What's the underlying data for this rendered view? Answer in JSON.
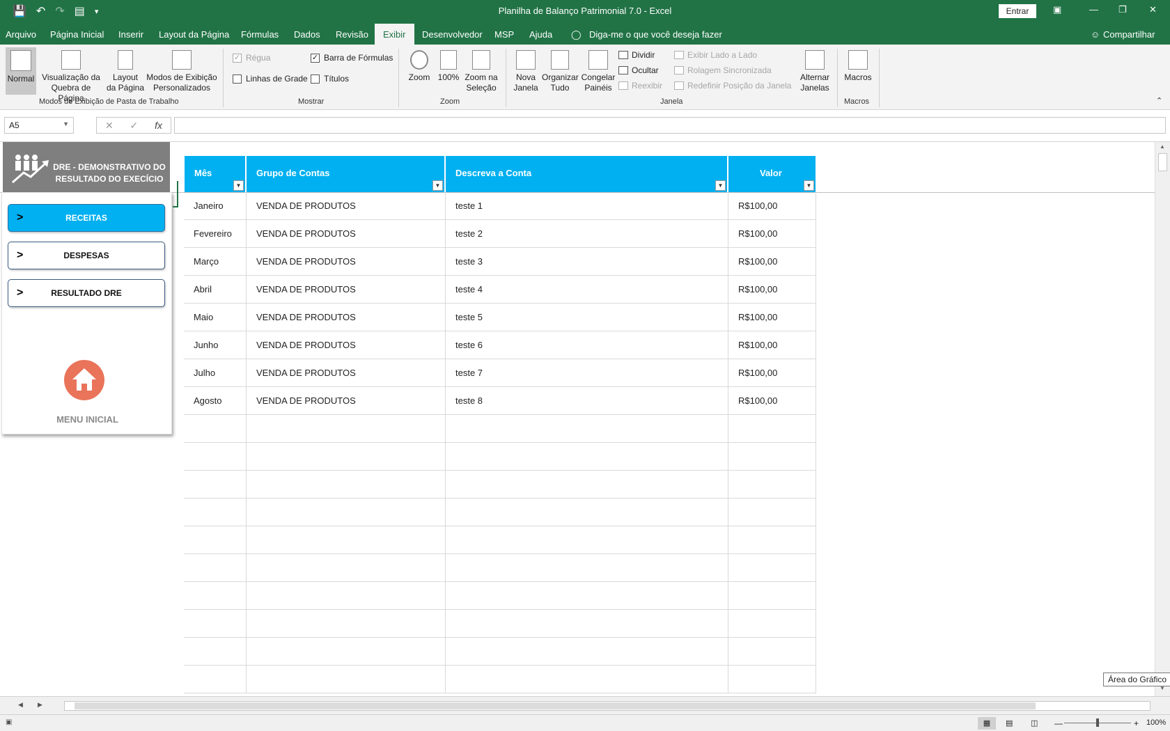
{
  "titlebar": {
    "title": "Planilha de Balanço Patrimonial 7.0  -  Excel",
    "signin": "Entrar"
  },
  "menu": {
    "tabs": [
      "Arquivo",
      "Página Inicial",
      "Inserir",
      "Layout da Página",
      "Fórmulas",
      "Dados",
      "Revisão",
      "Exibir",
      "Desenvolvedor",
      "MSP",
      "Ajuda"
    ],
    "active": "Exibir",
    "tell_me": "Diga-me o que você deseja fazer",
    "share": "Compartilhar"
  },
  "ribbon": {
    "workbook_views": {
      "normal": "Normal",
      "page_break_1": "Visualização da",
      "page_break_2": "Quebra de Página",
      "page_layout_1": "Layout",
      "page_layout_2": "da Página",
      "custom_1": "Modos de Exibição",
      "custom_2": "Personalizados",
      "group": "Modos de Exibição de Pasta de Trabalho"
    },
    "show": {
      "ruler": "Régua",
      "formula_bar": "Barra de Fórmulas",
      "gridlines": "Linhas de Grade",
      "headings": "Títulos",
      "group": "Mostrar"
    },
    "zoom": {
      "zoom": "Zoom",
      "hundred": "100%",
      "sel_1": "Zoom na",
      "sel_2": "Seleção",
      "group": "Zoom"
    },
    "window": {
      "new_1": "Nova",
      "new_2": "Janela",
      "arrange_1": "Organizar",
      "arrange_2": "Tudo",
      "freeze_1": "Congelar",
      "freeze_2": "Painéis",
      "split": "Dividir",
      "hide": "Ocultar",
      "unhide": "Reexibir",
      "side_by_side": "Exibir Lado a Lado",
      "sync_scroll": "Rolagem Sincronizada",
      "reset_pos": "Redefinir Posição da Janela",
      "switch_1": "Alternar",
      "switch_2": "Janelas",
      "group": "Janela"
    },
    "macros": {
      "macros": "Macros",
      "group": "Macros"
    }
  },
  "formula_bar": {
    "name_box": "A5",
    "fx": "fx",
    "value": ""
  },
  "panel": {
    "title_1": "DRE - DEMONSTRATIVO DO",
    "title_2": "RESULTADO  DO EXECÍCIO",
    "arrow": ">",
    "buttons": [
      "RECEITAS",
      "DESPESAS",
      "RESULTADO DRE"
    ],
    "home_label": "MENU INICIAL"
  },
  "table": {
    "headers": [
      "Mês",
      "Grupo de Contas",
      "Descreva a Conta",
      "Valor"
    ],
    "rows": [
      [
        "Janeiro",
        "VENDA DE PRODUTOS",
        "teste 1",
        "R$100,00"
      ],
      [
        "Fevereiro",
        "VENDA DE PRODUTOS",
        "teste 2",
        "R$100,00"
      ],
      [
        "Março",
        "VENDA DE PRODUTOS",
        "teste 3",
        "R$100,00"
      ],
      [
        "Abril",
        "VENDA DE PRODUTOS",
        "teste 4",
        "R$100,00"
      ],
      [
        "Maio",
        "VENDA DE PRODUTOS",
        "teste 5",
        "R$100,00"
      ],
      [
        "Junho",
        "VENDA DE PRODUTOS",
        "teste 6",
        "R$100,00"
      ],
      [
        "Julho",
        "VENDA DE PRODUTOS",
        "teste 7",
        "R$100,00"
      ],
      [
        "Agosto",
        "VENDA DE PRODUTOS",
        "teste 8",
        "R$100,00"
      ]
    ],
    "empty_rows": 10
  },
  "tooltip": "Área do Gráfico",
  "status": {
    "zoom": "100%"
  }
}
